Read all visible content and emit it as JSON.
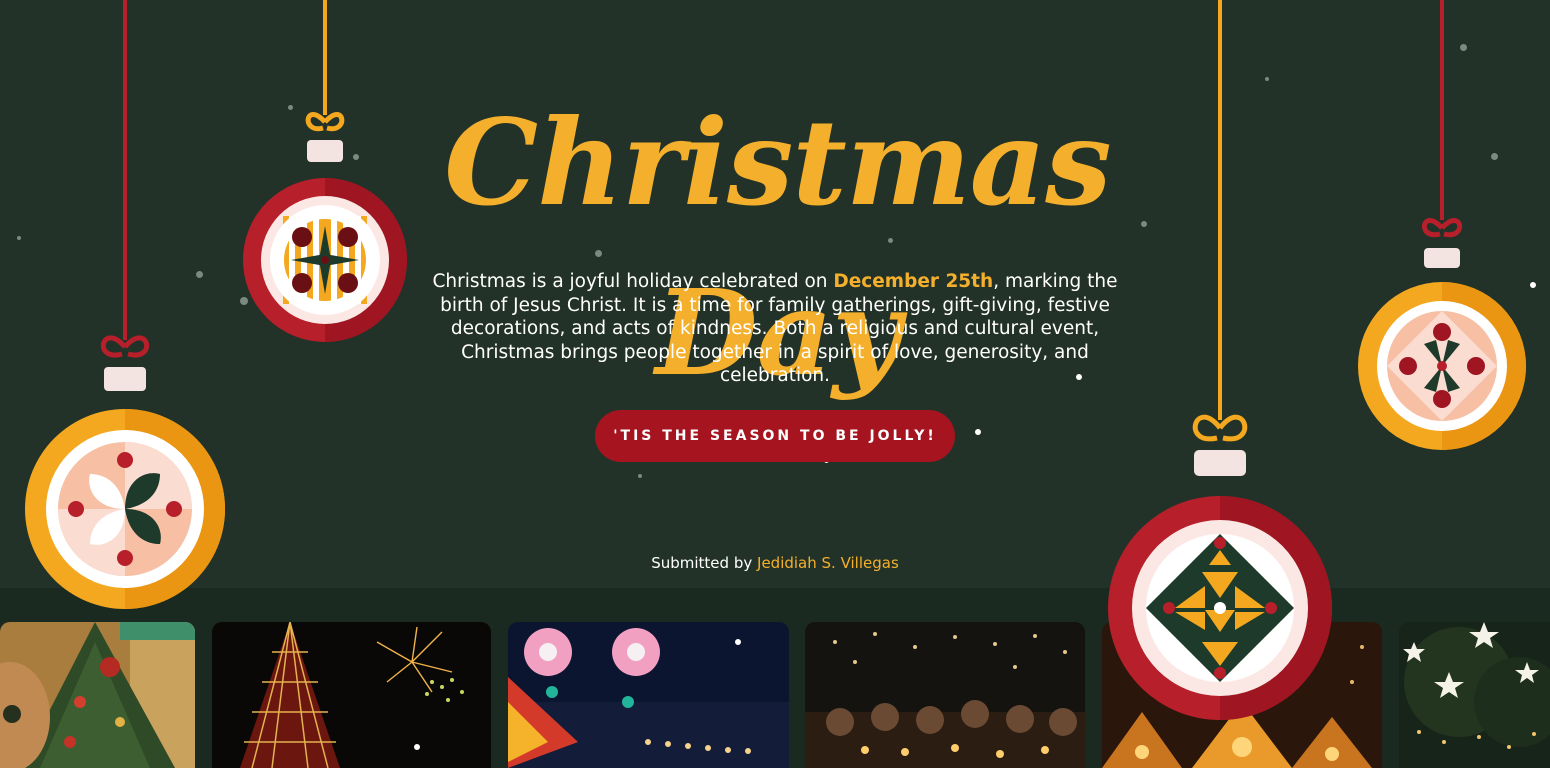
{
  "hero": {
    "title": "Christmas Day",
    "description_before": "Christmas is a joyful holiday celebrated on ",
    "description_highlight": "December 25th",
    "description_after": ", marking the birth of Jesus Christ. It is a time for family gatherings, gift-giving, festive decorations, and acts of kindness. Both a religious and cultural event, Christmas brings people together in a spirit of love, generosity, and celebration.",
    "cta_label": "'TIS THE SEASON TO BE JOLLY!",
    "credit_prefix": "Submitted by",
    "credit_author": "Jedidiah S. Villegas"
  },
  "colors": {
    "background": "#233228",
    "strip": "#1b2a21",
    "accent_gold": "#f4b02c",
    "accent_red": "#a6141f",
    "text": "#ffffff"
  },
  "gallery": {
    "photos": [
      {
        "subject": "christmas tree with cat"
      },
      {
        "subject": "giant lit christmas tree with fireworks"
      },
      {
        "subject": "parol lanterns along a street"
      },
      {
        "subject": "people lighting candles at night"
      },
      {
        "subject": "star lanterns glowing"
      },
      {
        "subject": "star lights in a tree"
      }
    ]
  }
}
